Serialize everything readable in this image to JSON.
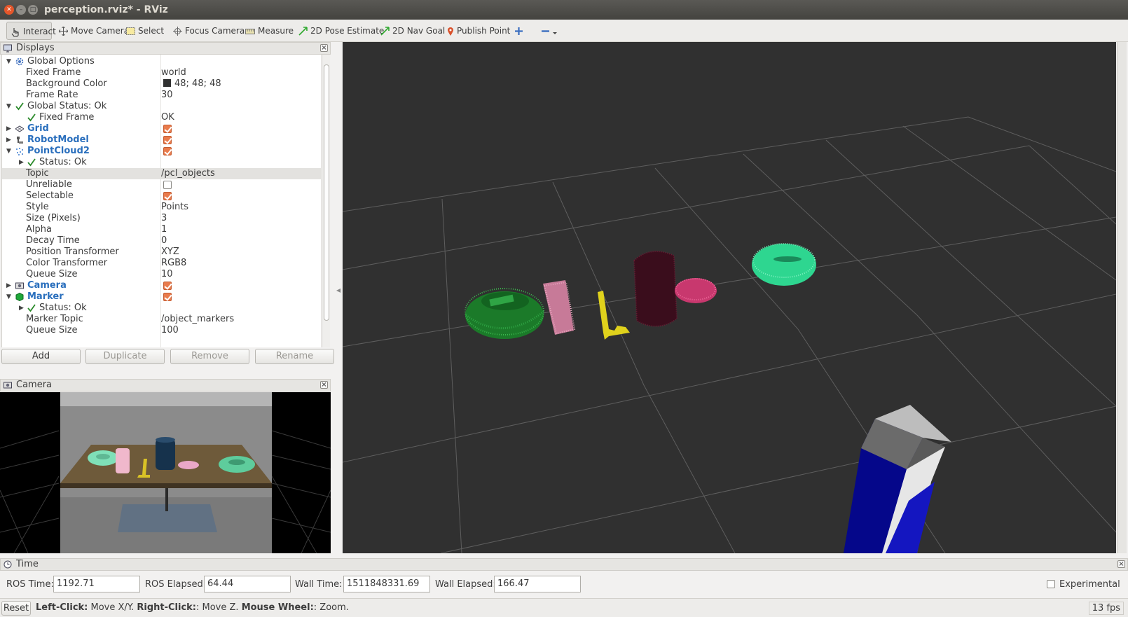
{
  "window": {
    "title": "perception.rviz* - RViz"
  },
  "toolbar": {
    "interact": "Interact",
    "move_camera": "Move Camera",
    "select": "Select",
    "focus_camera": "Focus Camera",
    "measure": "Measure",
    "pose_estimate": "2D Pose Estimate",
    "nav_goal": "2D Nav Goal",
    "publish_point": "Publish Point"
  },
  "displays": {
    "title": "Displays",
    "rows": [
      {
        "label": "Global Options",
        "value": ""
      },
      {
        "label": "Fixed Frame",
        "value": "world"
      },
      {
        "label": "Background Color",
        "value": "48; 48; 48"
      },
      {
        "label": "Frame Rate",
        "value": "30"
      },
      {
        "label": "Global Status: Ok",
        "value": ""
      },
      {
        "label": "Fixed Frame",
        "value": "OK"
      },
      {
        "label": "Grid",
        "value": ""
      },
      {
        "label": "RobotModel",
        "value": ""
      },
      {
        "label": "PointCloud2",
        "value": ""
      },
      {
        "label": "Status: Ok",
        "value": ""
      },
      {
        "label": "Topic",
        "value": "/pcl_objects"
      },
      {
        "label": "Unreliable",
        "value": ""
      },
      {
        "label": "Selectable",
        "value": ""
      },
      {
        "label": "Style",
        "value": "Points"
      },
      {
        "label": "Size (Pixels)",
        "value": "3"
      },
      {
        "label": "Alpha",
        "value": "1"
      },
      {
        "label": "Decay Time",
        "value": "0"
      },
      {
        "label": "Position Transformer",
        "value": "XYZ"
      },
      {
        "label": "Color Transformer",
        "value": "RGB8"
      },
      {
        "label": "Queue Size",
        "value": "10"
      },
      {
        "label": "Camera",
        "value": ""
      },
      {
        "label": "Marker",
        "value": ""
      },
      {
        "label": "Status: Ok",
        "value": ""
      },
      {
        "label": "Marker Topic",
        "value": "/object_markers"
      },
      {
        "label": "Queue Size",
        "value": "100"
      }
    ],
    "buttons": {
      "add": "Add",
      "duplicate": "Duplicate",
      "remove": "Remove",
      "rename": "Rename"
    }
  },
  "camera_panel": {
    "title": "Camera"
  },
  "time_panel": {
    "title": "Time",
    "ros_time_label": "ROS Time:",
    "ros_time": "1192.71",
    "ros_elapsed_label": "ROS Elapsed:",
    "ros_elapsed": "64.44",
    "wall_time_label": "Wall Time:",
    "wall_time": "1511848331.69",
    "wall_elapsed_label": "Wall Elapsed:",
    "wall_elapsed": "166.47",
    "experimental": "Experimental"
  },
  "status_bar": {
    "reset": "Reset",
    "left_click": "Left-Click:",
    "left_click_action": " Move X/Y. ",
    "right_click": "Right-Click:",
    "right_click_action": ": Move Z. ",
    "wheel": "Mouse Wheel:",
    "wheel_action": ": Zoom.",
    "fps": "13 fps"
  },
  "colors": {
    "background": "#303030",
    "green_bowl": "#1f8a2e",
    "pink_can": "#d47fa0",
    "yellow_tool": "#e0d21c",
    "maroon_can": "#3a0d1c",
    "pink_disc": "#d8467e",
    "teal_ring": "#2ed690",
    "robot_blue": "#0a0ea8",
    "robot_gray": "#a8a8a8"
  }
}
